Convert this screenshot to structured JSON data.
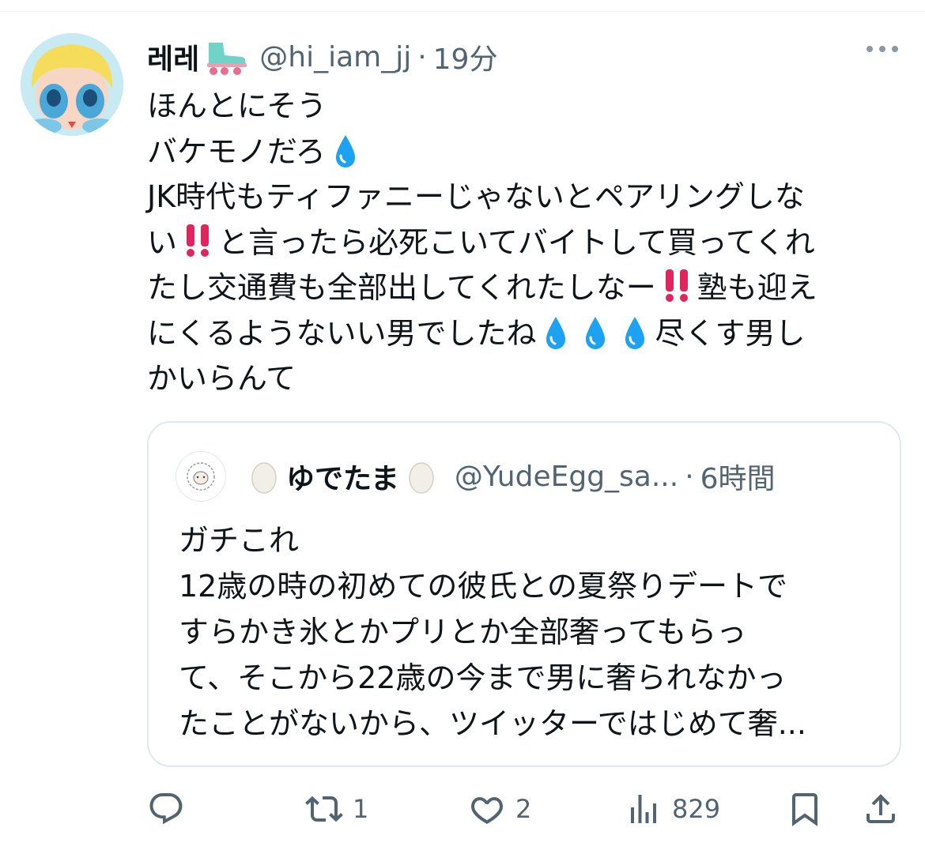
{
  "post": {
    "author_name": "레레",
    "author_handle": "@hi_iam_jj",
    "separator": "·",
    "time": "19分",
    "lines": [
      "ほんとにそう",
      "バケモノだろ",
      "JK時代もティファニーじゃないとペアリングしな",
      "い",
      "と言ったら必死こいてバイトして買ってくれ",
      "たし交通費も全部出してくれたしなー",
      "塾も迎え",
      "にくるようないい男でしたね",
      "尽くす男し",
      "かいらんて"
    ]
  },
  "quote": {
    "author_name": "ゆでたま",
    "author_handle": "@YudeEgg_sa...",
    "separator": "·",
    "time": "6時間",
    "lines": [
      "ガチこれ",
      "12歳の時の初めての彼氏との夏祭りデートで",
      "すらかき氷とかプリとか全部奢ってもらっ",
      "て、そこから22歳の今まで男に奢られなかっ",
      "たことがないから、ツイッターではじめて奢..."
    ]
  },
  "actions": {
    "reply_count": "",
    "retweet_count": "1",
    "like_count": "2",
    "views_count": "829"
  },
  "icons": {
    "reply": "reply-icon",
    "retweet": "retweet-icon",
    "like": "heart-icon",
    "views": "views-icon",
    "bookmark": "bookmark-icon",
    "share": "share-icon",
    "more": "more-icon"
  },
  "colors": {
    "text": "#0f1419",
    "secondary": "#536471",
    "border": "#e1e8ed",
    "drop": "#1da1f2",
    "bang": "#e0245e"
  }
}
